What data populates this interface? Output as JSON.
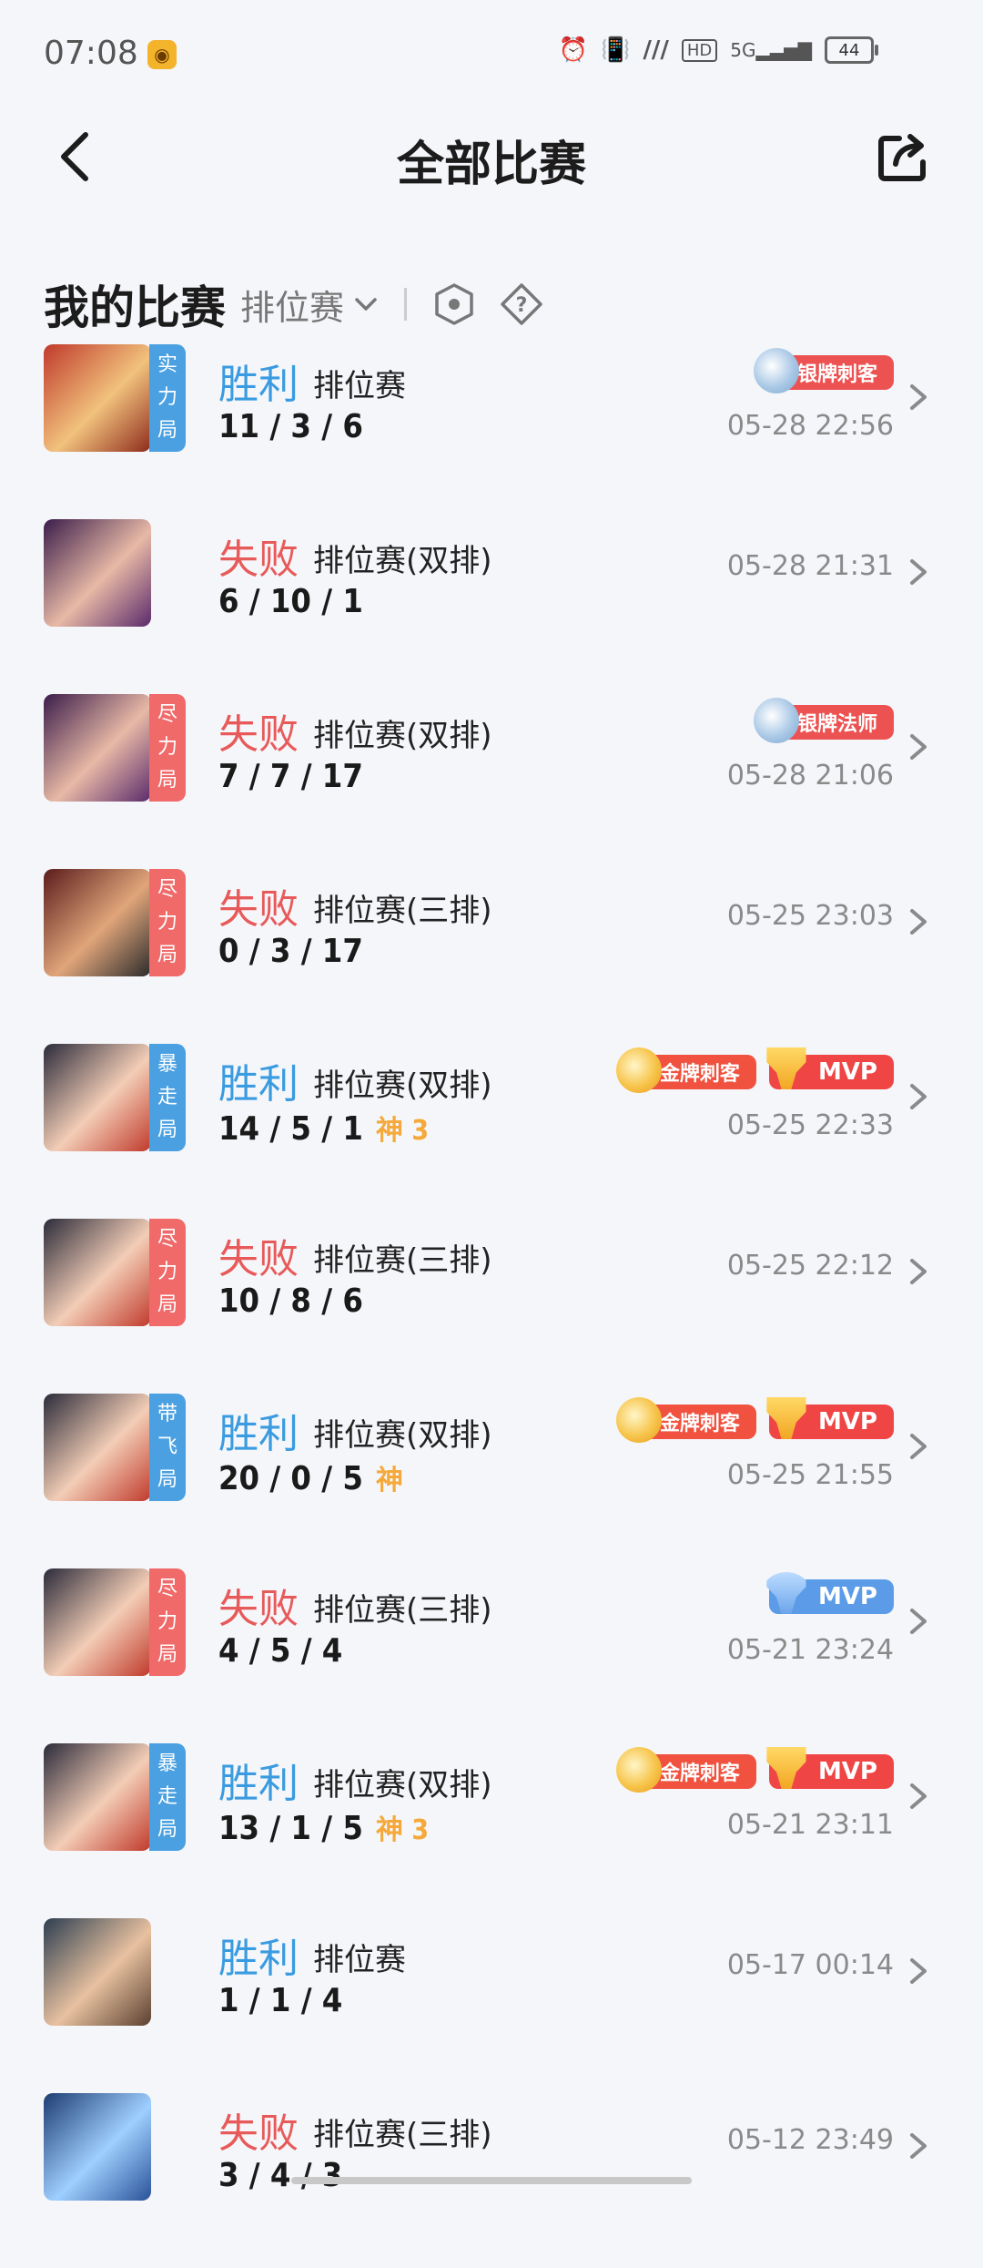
{
  "status": {
    "time": "07:08",
    "app_icon": "camera-app-icon",
    "battery": "44",
    "signal": "5G",
    "hd": "HD"
  },
  "header": {
    "title": "全部比赛"
  },
  "section": {
    "title": "我的比赛",
    "filter": "排位赛"
  },
  "matches": [
    {
      "result": "胜利",
      "mode": "排位赛",
      "kda": "11 / 3 / 6",
      "extra": "",
      "date": "05-28 22:56",
      "tag": [
        "实",
        "力",
        "局"
      ],
      "badges": [
        "银牌刺客"
      ]
    },
    {
      "result": "失败",
      "mode": "排位赛(双排)",
      "kda": "6 / 10 / 1",
      "extra": "",
      "date": "05-28 21:31",
      "tag": [],
      "badges": []
    },
    {
      "result": "失败",
      "mode": "排位赛(双排)",
      "kda": "7 / 7 / 17",
      "extra": "",
      "date": "05-28 21:06",
      "tag": [
        "尽",
        "力",
        "局"
      ],
      "badges": [
        "银牌法师"
      ]
    },
    {
      "result": "失败",
      "mode": "排位赛(三排)",
      "kda": "0 / 3 / 17",
      "extra": "",
      "date": "05-25 23:03",
      "tag": [
        "尽",
        "力",
        "局"
      ],
      "badges": []
    },
    {
      "result": "胜利",
      "mode": "排位赛(双排)",
      "kda": "14 / 5 / 1",
      "extra": "神 3",
      "date": "05-25 22:33",
      "tag": [
        "暴",
        "走",
        "局"
      ],
      "badges": [
        "金牌刺客",
        "MVP"
      ]
    },
    {
      "result": "失败",
      "mode": "排位赛(三排)",
      "kda": "10 / 8 / 6",
      "extra": "",
      "date": "05-25 22:12",
      "tag": [
        "尽",
        "力",
        "局"
      ],
      "badges": []
    },
    {
      "result": "胜利",
      "mode": "排位赛(双排)",
      "kda": "20 / 0 / 5",
      "extra": "神",
      "date": "05-25 21:55",
      "tag": [
        "带",
        "飞",
        "局"
      ],
      "badges": [
        "金牌刺客",
        "MVP"
      ]
    },
    {
      "result": "失败",
      "mode": "排位赛(三排)",
      "kda": "4 / 5 / 4",
      "extra": "",
      "date": "05-21 23:24",
      "tag": [
        "尽",
        "力",
        "局"
      ],
      "badges": [
        "MVP"
      ]
    },
    {
      "result": "胜利",
      "mode": "排位赛(双排)",
      "kda": "13 / 1 / 5",
      "extra": "神 3",
      "date": "05-21 23:11",
      "tag": [
        "暴",
        "走",
        "局"
      ],
      "badges": [
        "金牌刺客",
        "MVP"
      ]
    },
    {
      "result": "胜利",
      "mode": "排位赛",
      "kda": "1 / 1 / 4",
      "extra": "",
      "date": "05-17 00:14",
      "tag": [],
      "badges": []
    },
    {
      "result": "失败",
      "mode": "排位赛(三排)",
      "kda": "3 / 4 / 3",
      "extra": "",
      "date": "05-12 23:49",
      "tag": [],
      "badges": []
    }
  ]
}
